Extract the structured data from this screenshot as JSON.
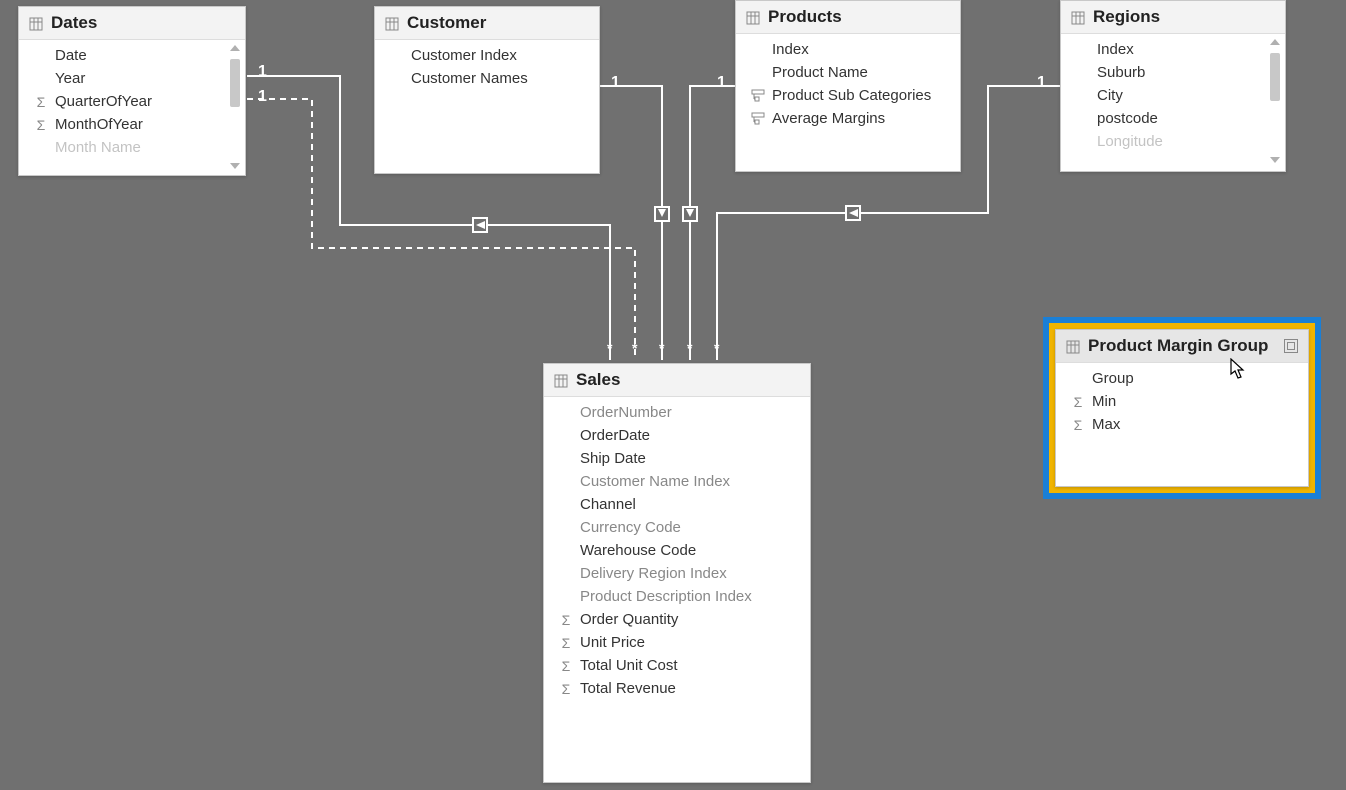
{
  "tables": {
    "dates": {
      "title": "Dates",
      "fields": [
        "Date",
        "Year",
        "QuarterOfYear",
        "MonthOfYear",
        "Month Name"
      ]
    },
    "customer": {
      "title": "Customer",
      "fields": [
        "Customer Index",
        "Customer Names"
      ]
    },
    "products": {
      "title": "Products",
      "fields": [
        "Index",
        "Product Name",
        "Product Sub Categories",
        "Average Margins"
      ]
    },
    "regions": {
      "title": "Regions",
      "fields": [
        "Index",
        "Suburb",
        "City",
        "postcode",
        "Longitude"
      ]
    },
    "sales": {
      "title": "Sales",
      "fields": [
        "OrderNumber",
        "OrderDate",
        "Ship Date",
        "Customer Name Index",
        "Channel",
        "Currency Code",
        "Warehouse Code",
        "Delivery Region Index",
        "Product Description Index",
        "Order Quantity",
        "Unit Price",
        "Total Unit Cost",
        "Total Revenue"
      ]
    },
    "pmg": {
      "title": "Product Margin Group",
      "fields": [
        "Group",
        "Min",
        "Max"
      ]
    }
  },
  "cardinality": {
    "one": "1",
    "many": "*"
  }
}
